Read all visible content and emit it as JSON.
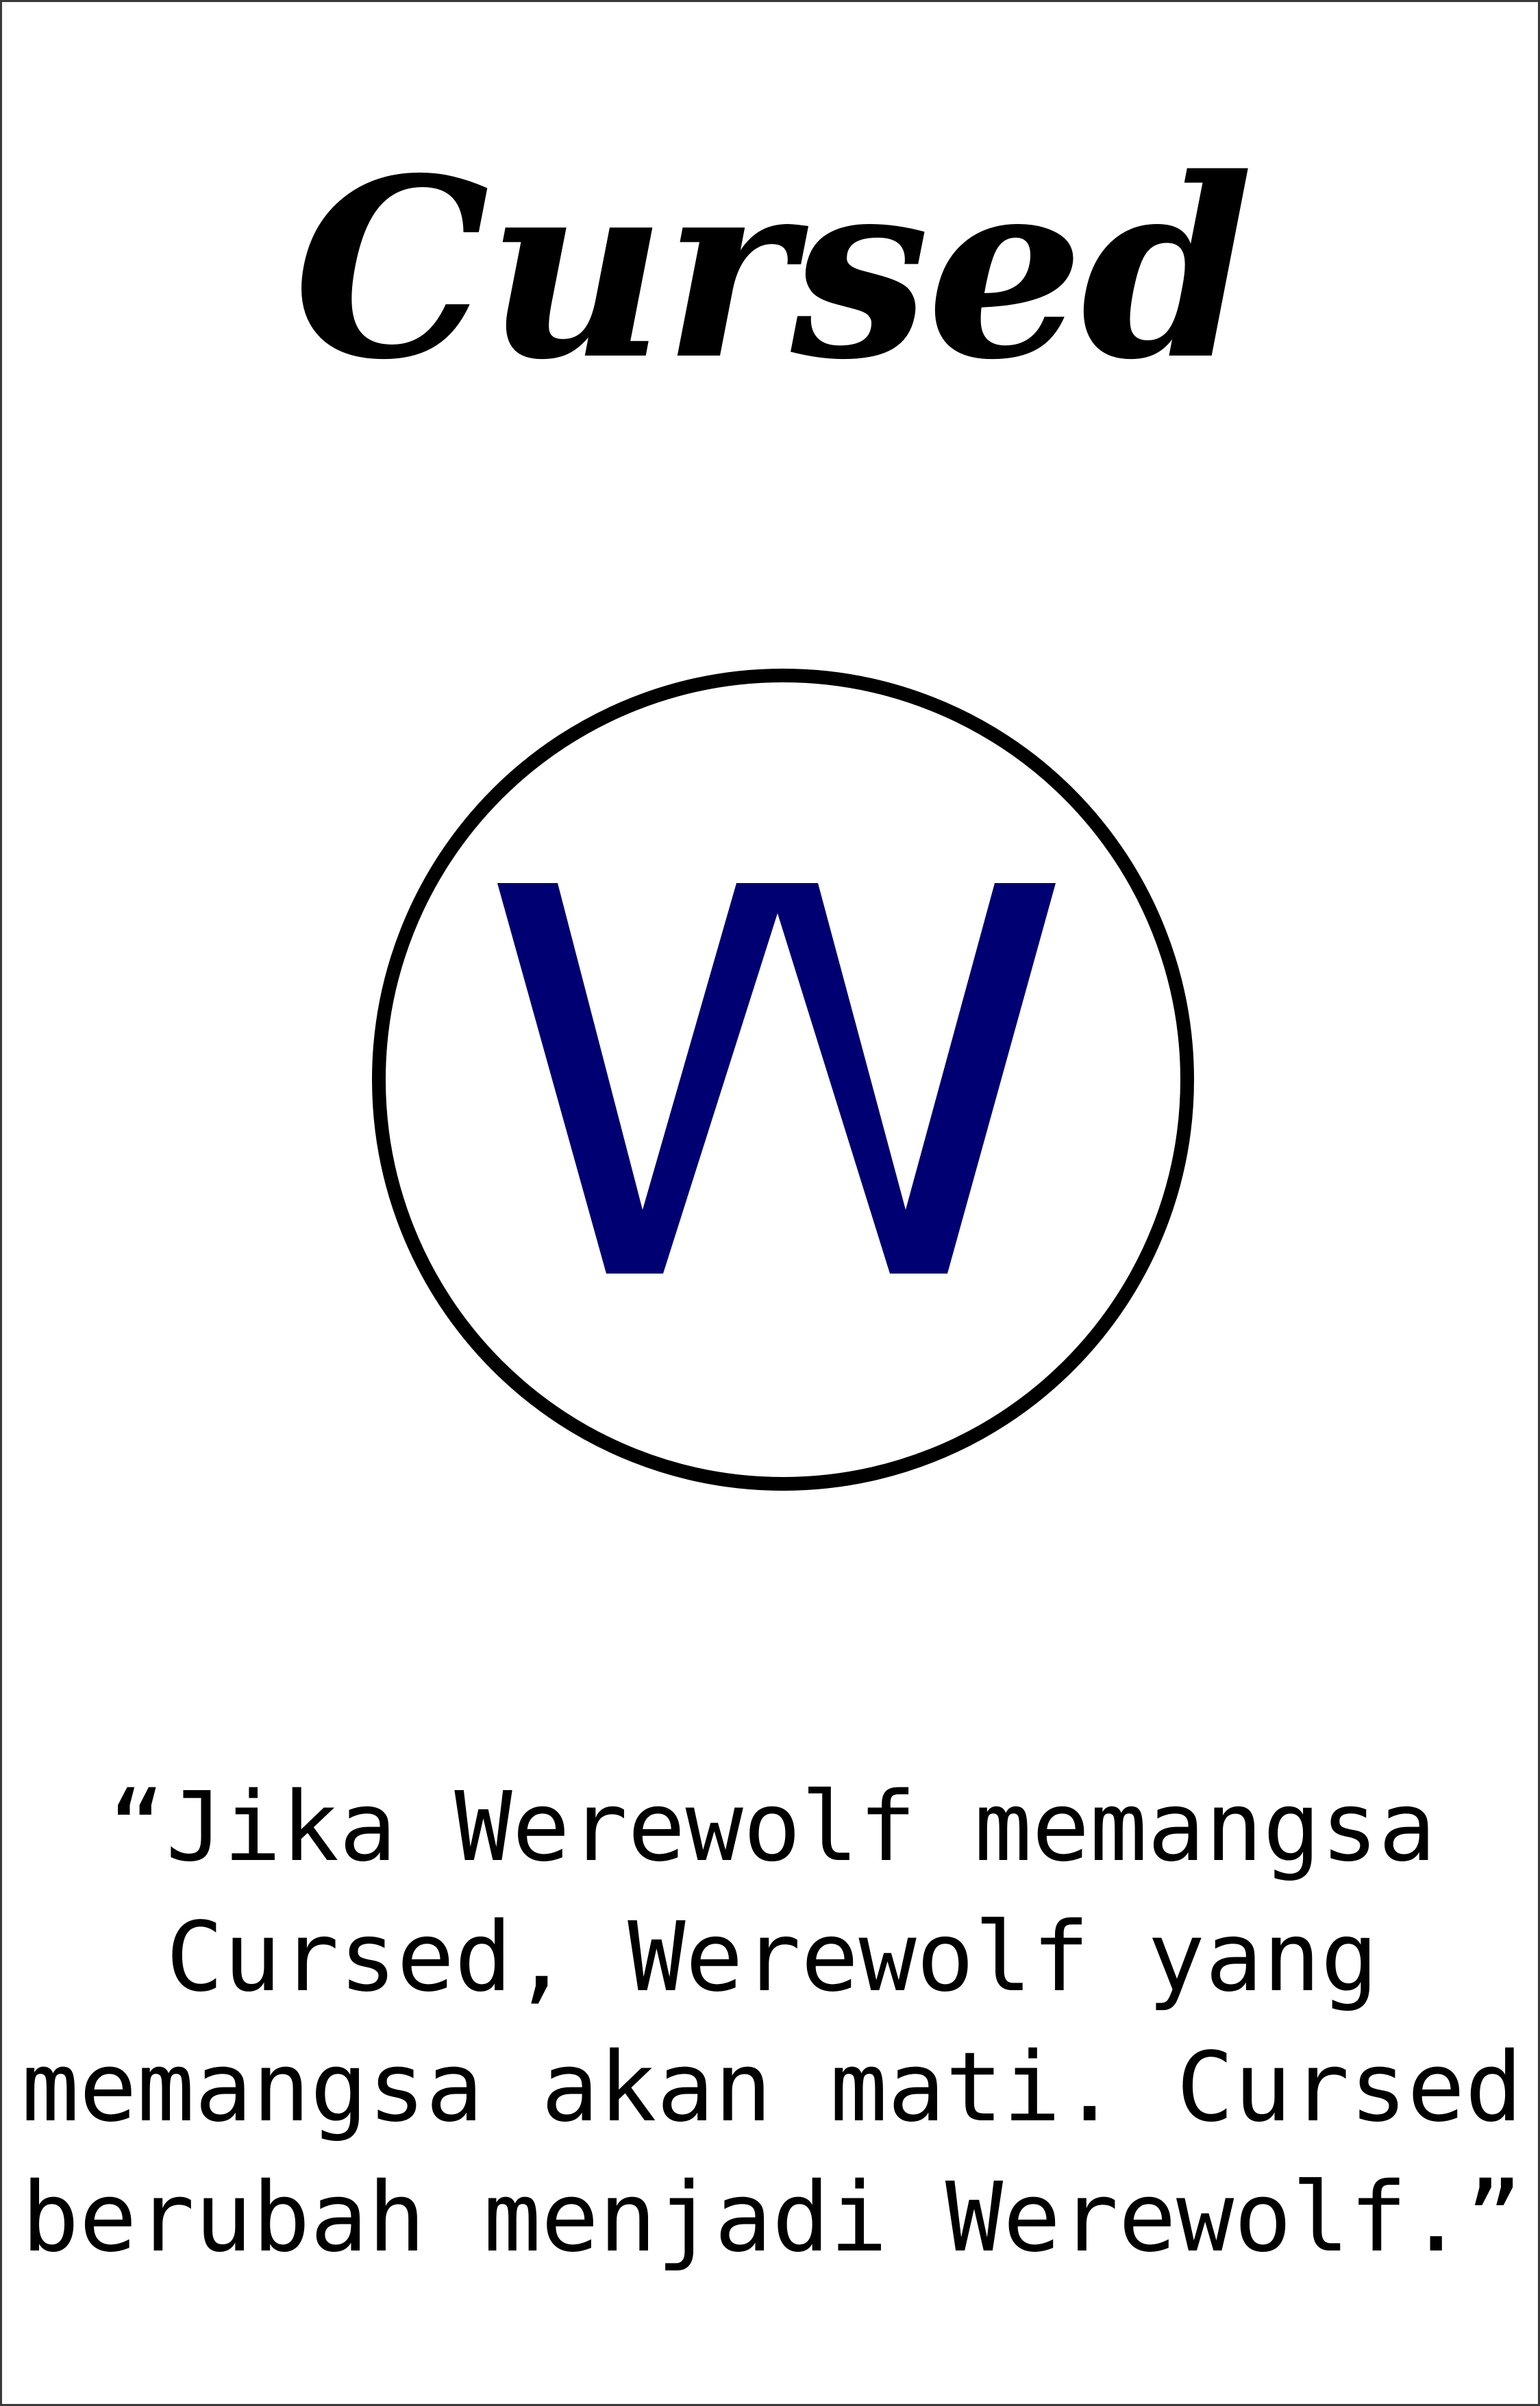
{
  "card": {
    "title": "Cursed",
    "emblem": {
      "letter": "W",
      "letter_color": "#000073",
      "ring_color": "#000000",
      "icon": "circle-w-icon"
    },
    "quote_lines": [
      "“Jika Werewolf memangsa",
      "Cursed, Werewolf yang",
      "memangsa akan mati. Cursed",
      "berubah menjadi Werewolf.”"
    ]
  }
}
